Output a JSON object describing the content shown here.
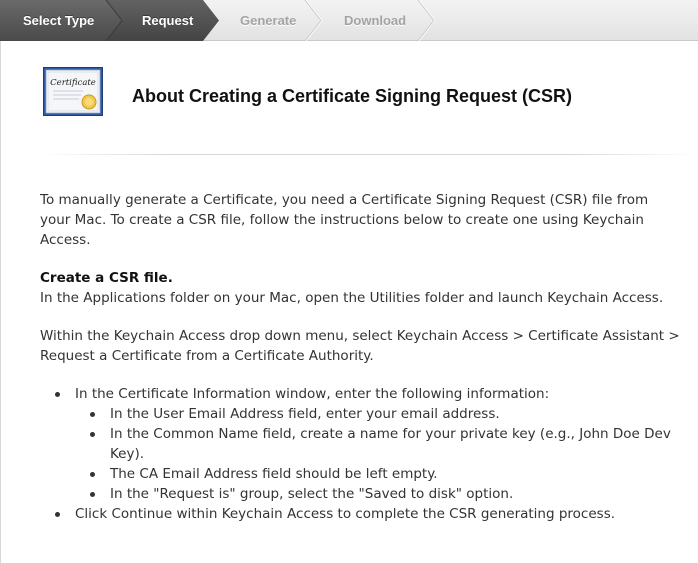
{
  "wizard": {
    "steps": [
      {
        "label": "Select Type",
        "state": "done"
      },
      {
        "label": "Request",
        "state": "active"
      },
      {
        "label": "Generate",
        "state": "upcoming"
      },
      {
        "label": "Download",
        "state": "upcoming"
      }
    ]
  },
  "header": {
    "icon_text": "Certificate",
    "title": "About Creating a Certificate Signing Request (CSR)"
  },
  "content": {
    "intro": "To manually generate a Certificate, you need a Certificate Signing Request (CSR) file from your Mac. To create a CSR file, follow the instructions below to create one using Keychain Access.",
    "section_heading": "Create a CSR file.",
    "section_text": "In the Applications folder on your Mac, open the Utilities folder and launch Keychain Access.",
    "menu_instruction": "Within the Keychain Access drop down menu, select Keychain Access > Certificate Assistant > Request a Certificate from a Certificate Authority.",
    "bullets": [
      {
        "text": "In the Certificate Information window, enter the following information:",
        "sub": [
          "In the User Email Address field, enter your email address.",
          "In the Common Name field, create a name for your private key (e.g., John Doe Dev Key).",
          "The CA Email Address field should be left empty.",
          "In the \"Request is\" group, select the \"Saved to disk\" option."
        ]
      },
      {
        "text": "Click Continue within Keychain Access to complete the CSR generating process."
      }
    ]
  },
  "colors": {
    "step_done": "#4c4c4c",
    "step_active": "#5a5a5a",
    "step_upcoming": "#e6e6e6"
  }
}
